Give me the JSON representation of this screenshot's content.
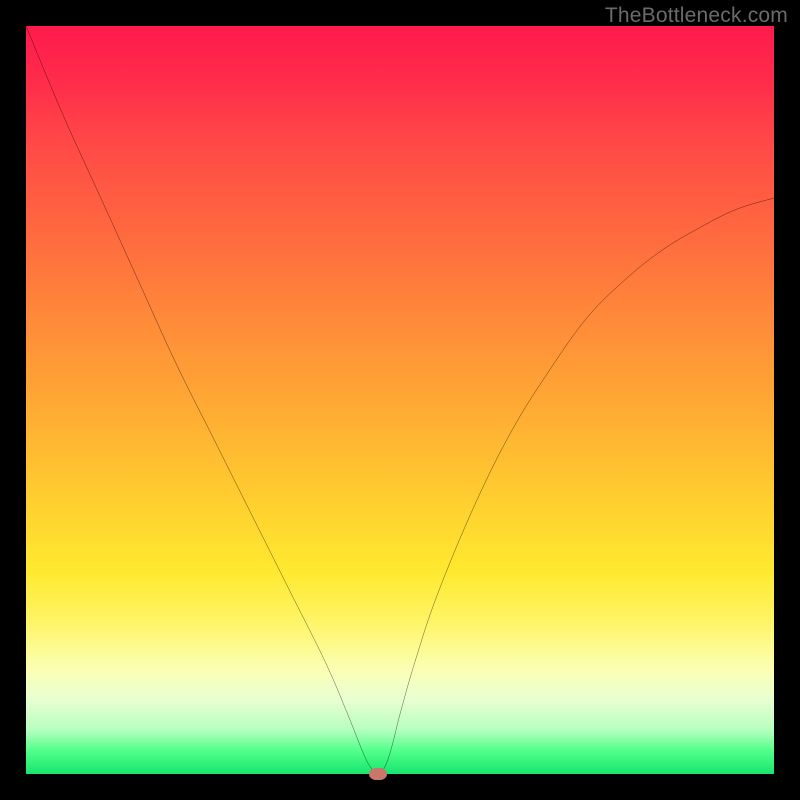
{
  "watermark": "TheBottleneck.com",
  "chart_data": {
    "type": "line",
    "title": "",
    "xlabel": "",
    "ylabel": "",
    "xlim": [
      0,
      100
    ],
    "ylim": [
      0,
      100
    ],
    "series": [
      {
        "name": "curve",
        "x": [
          0,
          5,
          10,
          15,
          20,
          25,
          30,
          35,
          40,
          43,
          45,
          46,
          47,
          48,
          49,
          50,
          52,
          55,
          60,
          65,
          70,
          75,
          80,
          85,
          90,
          95,
          100
        ],
        "values": [
          100,
          88,
          77,
          66,
          55,
          45,
          35,
          25,
          15,
          8,
          3,
          1,
          0,
          1,
          4,
          8,
          15,
          24,
          36,
          46,
          54,
          61,
          66,
          70,
          73,
          75.5,
          77
        ]
      }
    ],
    "marker": {
      "x": 47,
      "y": 0,
      "color": "#c9766b"
    }
  }
}
